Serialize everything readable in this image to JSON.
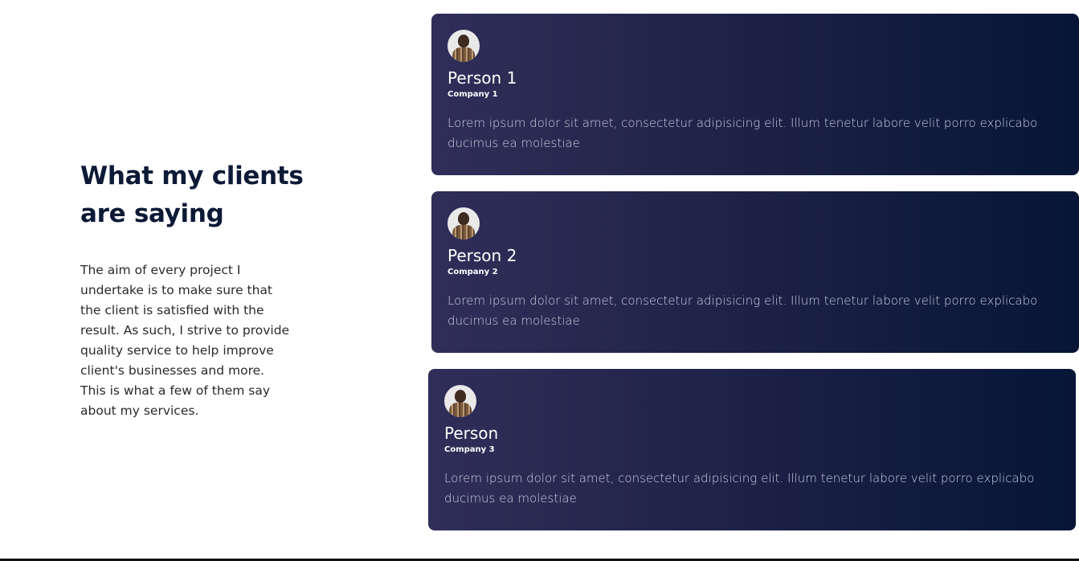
{
  "section": {
    "heading": "What my clients are saying",
    "description": "The aim of every project I undertake is to make sure that the client is satisfied with the result. As such, I strive to provide quality service to help improve client's businesses and more. This is what a few of them say about my services."
  },
  "testimonials": [
    {
      "name": "Person 1",
      "company": "Company 1",
      "quote": "Lorem ipsum dolor sit amet, consectetur adipisicing elit. Illum tenetur labore velit porro explicabo ducimus ea molestiae"
    },
    {
      "name": "Person 2",
      "company": "Company 2",
      "quote": "Lorem ipsum dolor sit amet, consectetur adipisicing elit. Illum tenetur labore velit porro explicabo ducimus ea molestiae"
    },
    {
      "name": "Person",
      "company": "Company 3",
      "quote": "Lorem ipsum dolor sit amet, consectetur adipisicing elit. Illum tenetur labore velit porro explicabo ducimus ea molestiae"
    }
  ],
  "colors": {
    "heading": "#0c1a36",
    "card_gradient_start": "#302e59",
    "card_gradient_end": "#071536",
    "quote_text": "#c9cbe0"
  }
}
